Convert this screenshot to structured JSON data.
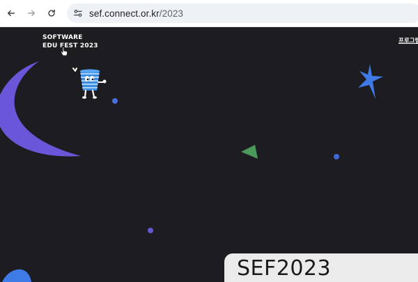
{
  "browser": {
    "url_host": "sef.connect.or.kr",
    "url_path": "/2023"
  },
  "site": {
    "logo_line1": "SOFTWARE",
    "logo_line2": "EDU FEST 2023",
    "nav_item": "프로그램",
    "hero_title": "SEF2023"
  },
  "colors": {
    "page_bg": "#1d1c20",
    "moon": "#6a56d8",
    "star": "#3f7be6",
    "triangle": "#4a9a5c",
    "card_bg": "#ecebeb"
  },
  "icons": [
    "back-arrow-icon",
    "forward-arrow-icon",
    "reload-icon",
    "site-info-icon",
    "hand-cursor-icon"
  ]
}
